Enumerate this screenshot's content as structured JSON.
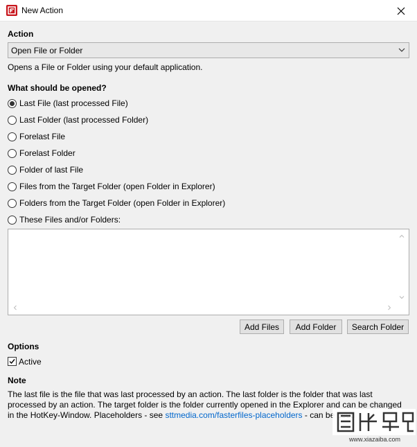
{
  "window": {
    "title": "New Action",
    "icon": "app-logo-icon",
    "close_icon": "close-icon"
  },
  "action": {
    "label": "Action",
    "selected": "Open File or Folder",
    "description": "Opens a File or Folder using your default application."
  },
  "open": {
    "label": "What should be opened?",
    "options": [
      {
        "label": "Last File (last processed File)",
        "checked": true
      },
      {
        "label": "Last Folder (last processed Folder)",
        "checked": false
      },
      {
        "label": "Forelast File",
        "checked": false
      },
      {
        "label": "Forelast Folder",
        "checked": false
      },
      {
        "label": "Folder of last File",
        "checked": false
      },
      {
        "label": "Files from the Target Folder (open Folder in Explorer)",
        "checked": false
      },
      {
        "label": "Folders from the Target Folder (open Folder in Explorer)",
        "checked": false
      },
      {
        "label": "These Files and/or Folders:",
        "checked": false
      }
    ]
  },
  "paths_text": "",
  "buttons": {
    "add_files": "Add Files",
    "add_folder": "Add Folder",
    "search_folder": "Search Folder"
  },
  "options": {
    "label": "Options",
    "active_label": "Active",
    "active_checked": true
  },
  "note": {
    "label": "Note",
    "text_before": "The last file is the file that was last processed by an action. The last folder is the folder that was last processed by an action. The target folder is the folder currently opened in the Explorer and can be changed in the HotKey-Window. Placeholders - see ",
    "link": "sttmedia.com/fasterfiles-placeholders",
    "text_after": " - can be used"
  },
  "watermark": {
    "text": "www.xiazaiba.com"
  },
  "colors": {
    "link": "#0066cc",
    "brand": "#c8161d",
    "background": "#f0f0f0"
  }
}
